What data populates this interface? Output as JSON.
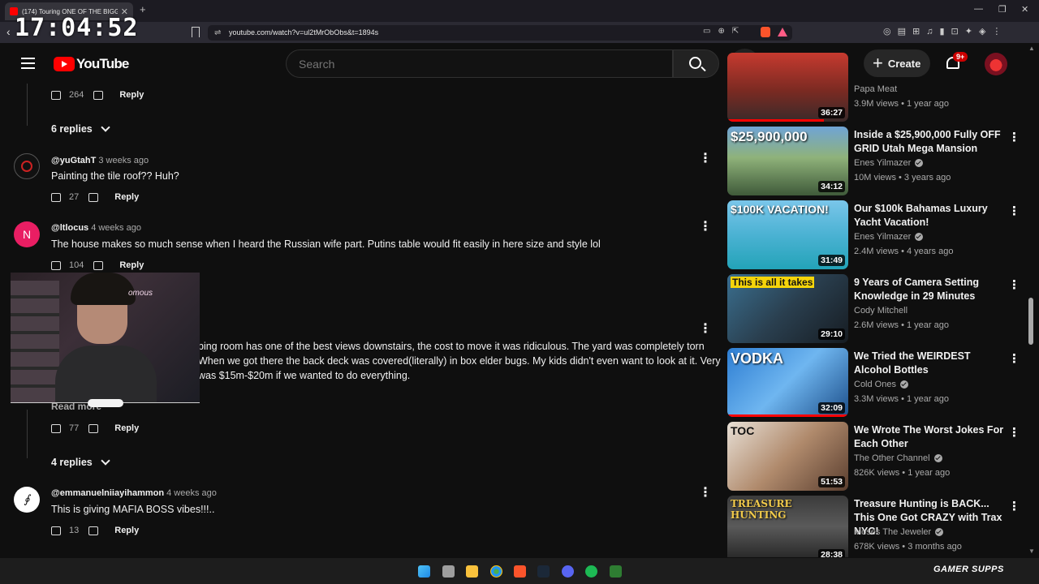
{
  "browser": {
    "tab_title": "(174) Touring ONE OF THE BIGG",
    "clock": "17:04:52",
    "url": "youtube.com/watch?v=ul2tMrObObs&t=1894s"
  },
  "header": {
    "logo_text": "YouTube",
    "search_placeholder": "Search",
    "create_label": "Create",
    "notification_badge": "9+"
  },
  "comments": {
    "c0": {
      "likes": "264",
      "reply_label": "Reply",
      "replies_label": "6 replies"
    },
    "c1": {
      "handle": "@yuGtahT",
      "ago": "3 weeks ago",
      "text": "Painting the tile roof?? Huh?",
      "likes": "27",
      "reply_label": "Reply"
    },
    "c2": {
      "avatar_letter": "N",
      "handle": "@ltlocus",
      "ago": "4 weeks ago",
      "text": "The house makes so much sense when I heard the Russian wife part. Putins table would fit easily in here size and style lol",
      "likes": "104",
      "reply_label": "Reply"
    },
    "c3": {
      "line1": "bing room has one of the best views downstairs, the cost to move it was ridiculous. The yard was completely torn",
      "line2": "When we got there the back deck was covered(literally) in box elder bugs. My kids didn't even want to look at it. Very",
      "line3": "was $15m-$20m if we wanted to do everything.",
      "read_more": "Read more",
      "likes": "77",
      "reply_label": "Reply",
      "replies_label": "4 replies"
    },
    "c4": {
      "handle": "@emmanuelniiayihammon",
      "ago": "4 weeks ago",
      "text": "This is giving MAFIA BOSS vibes!!!..",
      "likes": "13",
      "reply_label": "Reply"
    }
  },
  "webcam": {
    "sign_text": "omous"
  },
  "sidebar": {
    "v0": {
      "channel": "Papa Meat",
      "meta": "3.9M views • 1 year ago",
      "duration": "36:27"
    },
    "v1": {
      "title": "Inside a $25,900,000 Fully OFF GRID Utah Mega Mansion",
      "channel": "Enes Yilmazer",
      "meta": "10M views • 3 years ago",
      "duration": "34:12",
      "thumb_caption": "$25,900,000"
    },
    "v2": {
      "title": "Our $100k Bahamas Luxury Yacht Vacation!",
      "channel": "Enes Yilmazer",
      "meta": "2.4M views • 4 years ago",
      "duration": "31:49",
      "thumb_caption": "$100K VACATION!"
    },
    "v3": {
      "title": "9 Years of Camera Setting Knowledge in 29 Minutes",
      "channel": "Cody Mitchell",
      "meta": "2.6M views • 1 year ago",
      "duration": "29:10",
      "thumb_caption": "This is all it takes"
    },
    "v4": {
      "title": "We Tried the WEIRDEST Alcohol Bottles",
      "channel": "Cold Ones",
      "meta": "3.3M views • 1 year ago",
      "duration": "32:09",
      "thumb_caption": "VODKA"
    },
    "v5": {
      "title": "We Wrote The Worst Jokes For Each Other",
      "channel": "The Other Channel",
      "meta": "826K views • 1 year ago",
      "duration": "51:53",
      "thumb_caption": "TOC"
    },
    "v6": {
      "title": "Treasure Hunting is BACK... This One Got CRAZY with Trax NYC!",
      "channel": "Moses The Jeweler",
      "meta": "678K views • 3 months ago",
      "duration": "28:38",
      "thumb_caption": "TREASURE HUNTING"
    }
  },
  "taskbar": {
    "watermark": "GAMER SUPPS"
  }
}
